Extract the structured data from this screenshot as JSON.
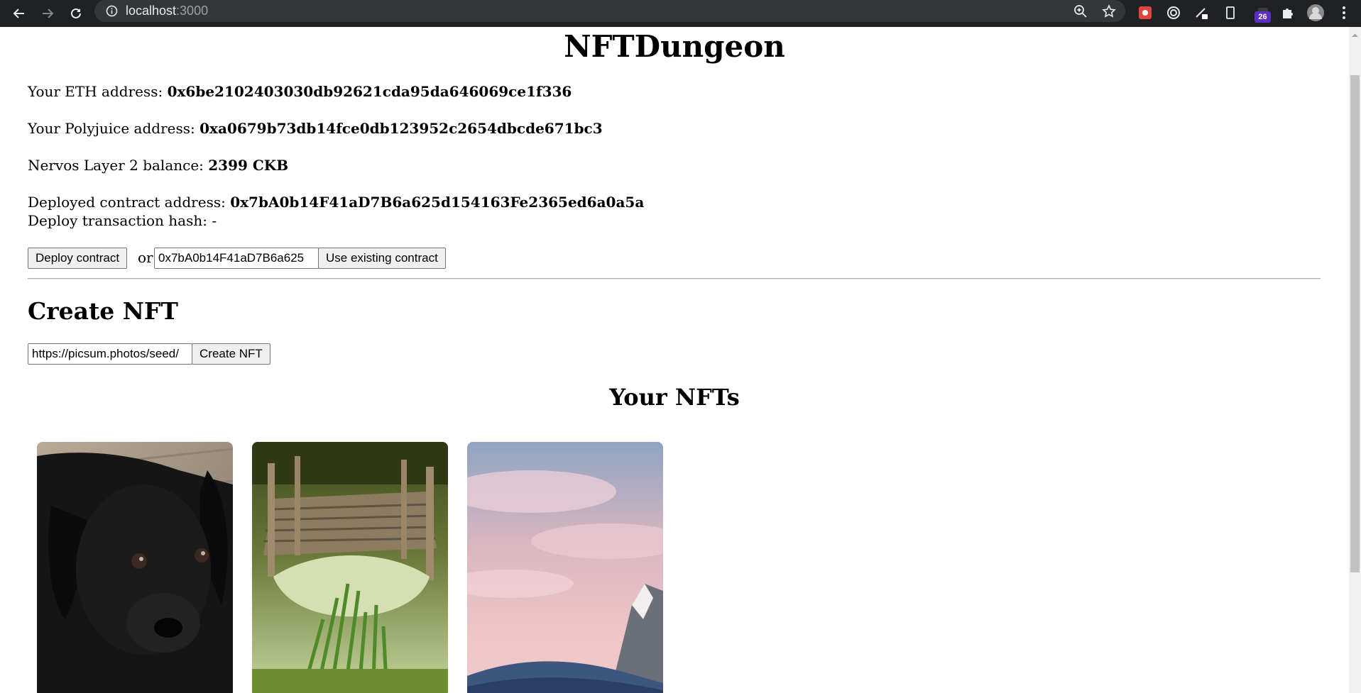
{
  "browser": {
    "url_host": "localhost",
    "url_port": ":3000",
    "extension_badge": "26"
  },
  "page": {
    "title": "NFTDungeon",
    "eth_address_label": "Your ETH address:",
    "eth_address": "0x6be2102403030db92621cda95da646069ce1f336",
    "polyjuice_address_label": "Your Polyjuice address:",
    "polyjuice_address": "0xa0679b73db14fce0db123952c2654dbcde671bc3",
    "balance_label": "Nervos Layer 2 balance:",
    "balance": "2399 CKB",
    "contract_address_label": "Deployed contract address:",
    "contract_address": "0x7bA0b14F41aD7B6a625d154163Fe2365ed6a0a5a",
    "deploy_tx_label": "Deploy transaction hash:",
    "deploy_tx_value": "-",
    "deploy_button": "Deploy contract",
    "or_text": "or",
    "existing_contract_input_value": "0x7bA0b14F41aD7B6a625",
    "use_existing_button": "Use existing contract",
    "create_heading": "Create NFT",
    "nft_url_input_value": "https://picsum.photos/seed/",
    "create_button": "Create NFT",
    "your_nfts_heading": "Your NFTs"
  },
  "nfts": [
    {
      "subject": "black puppy"
    },
    {
      "subject": "wooden dock over pond"
    },
    {
      "subject": "pink sky and snowy mountain"
    }
  ]
}
